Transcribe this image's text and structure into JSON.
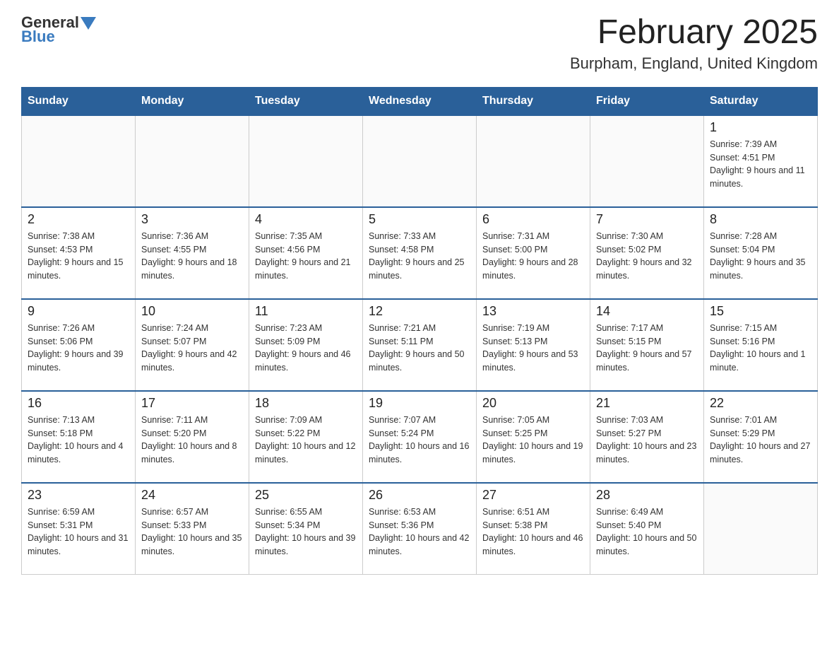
{
  "header": {
    "logo_text1": "General",
    "logo_text2": "Blue",
    "title": "February 2025",
    "subtitle": "Burpham, England, United Kingdom"
  },
  "days_of_week": [
    "Sunday",
    "Monday",
    "Tuesday",
    "Wednesday",
    "Thursday",
    "Friday",
    "Saturday"
  ],
  "weeks": [
    [
      {
        "day": "",
        "sunrise": "",
        "sunset": "",
        "daylight": ""
      },
      {
        "day": "",
        "sunrise": "",
        "sunset": "",
        "daylight": ""
      },
      {
        "day": "",
        "sunrise": "",
        "sunset": "",
        "daylight": ""
      },
      {
        "day": "",
        "sunrise": "",
        "sunset": "",
        "daylight": ""
      },
      {
        "day": "",
        "sunrise": "",
        "sunset": "",
        "daylight": ""
      },
      {
        "day": "",
        "sunrise": "",
        "sunset": "",
        "daylight": ""
      },
      {
        "day": "1",
        "sunrise": "Sunrise: 7:39 AM",
        "sunset": "Sunset: 4:51 PM",
        "daylight": "Daylight: 9 hours and 11 minutes."
      }
    ],
    [
      {
        "day": "2",
        "sunrise": "Sunrise: 7:38 AM",
        "sunset": "Sunset: 4:53 PM",
        "daylight": "Daylight: 9 hours and 15 minutes."
      },
      {
        "day": "3",
        "sunrise": "Sunrise: 7:36 AM",
        "sunset": "Sunset: 4:55 PM",
        "daylight": "Daylight: 9 hours and 18 minutes."
      },
      {
        "day": "4",
        "sunrise": "Sunrise: 7:35 AM",
        "sunset": "Sunset: 4:56 PM",
        "daylight": "Daylight: 9 hours and 21 minutes."
      },
      {
        "day": "5",
        "sunrise": "Sunrise: 7:33 AM",
        "sunset": "Sunset: 4:58 PM",
        "daylight": "Daylight: 9 hours and 25 minutes."
      },
      {
        "day": "6",
        "sunrise": "Sunrise: 7:31 AM",
        "sunset": "Sunset: 5:00 PM",
        "daylight": "Daylight: 9 hours and 28 minutes."
      },
      {
        "day": "7",
        "sunrise": "Sunrise: 7:30 AM",
        "sunset": "Sunset: 5:02 PM",
        "daylight": "Daylight: 9 hours and 32 minutes."
      },
      {
        "day": "8",
        "sunrise": "Sunrise: 7:28 AM",
        "sunset": "Sunset: 5:04 PM",
        "daylight": "Daylight: 9 hours and 35 minutes."
      }
    ],
    [
      {
        "day": "9",
        "sunrise": "Sunrise: 7:26 AM",
        "sunset": "Sunset: 5:06 PM",
        "daylight": "Daylight: 9 hours and 39 minutes."
      },
      {
        "day": "10",
        "sunrise": "Sunrise: 7:24 AM",
        "sunset": "Sunset: 5:07 PM",
        "daylight": "Daylight: 9 hours and 42 minutes."
      },
      {
        "day": "11",
        "sunrise": "Sunrise: 7:23 AM",
        "sunset": "Sunset: 5:09 PM",
        "daylight": "Daylight: 9 hours and 46 minutes."
      },
      {
        "day": "12",
        "sunrise": "Sunrise: 7:21 AM",
        "sunset": "Sunset: 5:11 PM",
        "daylight": "Daylight: 9 hours and 50 minutes."
      },
      {
        "day": "13",
        "sunrise": "Sunrise: 7:19 AM",
        "sunset": "Sunset: 5:13 PM",
        "daylight": "Daylight: 9 hours and 53 minutes."
      },
      {
        "day": "14",
        "sunrise": "Sunrise: 7:17 AM",
        "sunset": "Sunset: 5:15 PM",
        "daylight": "Daylight: 9 hours and 57 minutes."
      },
      {
        "day": "15",
        "sunrise": "Sunrise: 7:15 AM",
        "sunset": "Sunset: 5:16 PM",
        "daylight": "Daylight: 10 hours and 1 minute."
      }
    ],
    [
      {
        "day": "16",
        "sunrise": "Sunrise: 7:13 AM",
        "sunset": "Sunset: 5:18 PM",
        "daylight": "Daylight: 10 hours and 4 minutes."
      },
      {
        "day": "17",
        "sunrise": "Sunrise: 7:11 AM",
        "sunset": "Sunset: 5:20 PM",
        "daylight": "Daylight: 10 hours and 8 minutes."
      },
      {
        "day": "18",
        "sunrise": "Sunrise: 7:09 AM",
        "sunset": "Sunset: 5:22 PM",
        "daylight": "Daylight: 10 hours and 12 minutes."
      },
      {
        "day": "19",
        "sunrise": "Sunrise: 7:07 AM",
        "sunset": "Sunset: 5:24 PM",
        "daylight": "Daylight: 10 hours and 16 minutes."
      },
      {
        "day": "20",
        "sunrise": "Sunrise: 7:05 AM",
        "sunset": "Sunset: 5:25 PM",
        "daylight": "Daylight: 10 hours and 19 minutes."
      },
      {
        "day": "21",
        "sunrise": "Sunrise: 7:03 AM",
        "sunset": "Sunset: 5:27 PM",
        "daylight": "Daylight: 10 hours and 23 minutes."
      },
      {
        "day": "22",
        "sunrise": "Sunrise: 7:01 AM",
        "sunset": "Sunset: 5:29 PM",
        "daylight": "Daylight: 10 hours and 27 minutes."
      }
    ],
    [
      {
        "day": "23",
        "sunrise": "Sunrise: 6:59 AM",
        "sunset": "Sunset: 5:31 PM",
        "daylight": "Daylight: 10 hours and 31 minutes."
      },
      {
        "day": "24",
        "sunrise": "Sunrise: 6:57 AM",
        "sunset": "Sunset: 5:33 PM",
        "daylight": "Daylight: 10 hours and 35 minutes."
      },
      {
        "day": "25",
        "sunrise": "Sunrise: 6:55 AM",
        "sunset": "Sunset: 5:34 PM",
        "daylight": "Daylight: 10 hours and 39 minutes."
      },
      {
        "day": "26",
        "sunrise": "Sunrise: 6:53 AM",
        "sunset": "Sunset: 5:36 PM",
        "daylight": "Daylight: 10 hours and 42 minutes."
      },
      {
        "day": "27",
        "sunrise": "Sunrise: 6:51 AM",
        "sunset": "Sunset: 5:38 PM",
        "daylight": "Daylight: 10 hours and 46 minutes."
      },
      {
        "day": "28",
        "sunrise": "Sunrise: 6:49 AM",
        "sunset": "Sunset: 5:40 PM",
        "daylight": "Daylight: 10 hours and 50 minutes."
      },
      {
        "day": "",
        "sunrise": "",
        "sunset": "",
        "daylight": ""
      }
    ]
  ]
}
